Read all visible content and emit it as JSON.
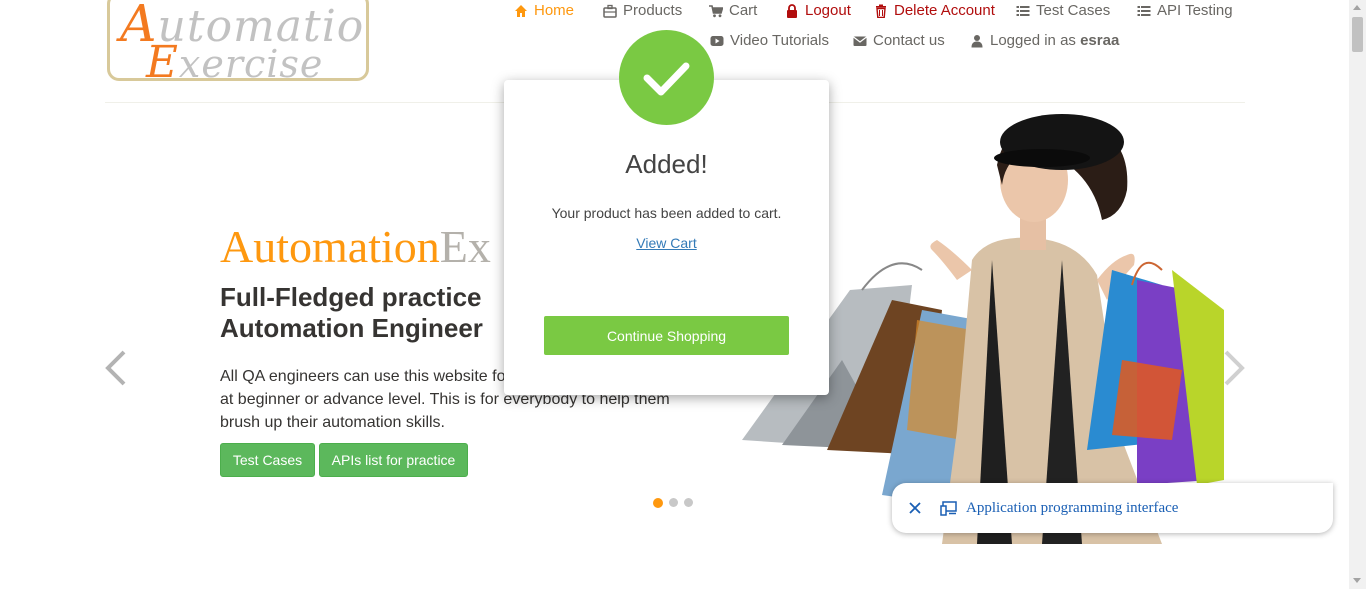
{
  "logo": {
    "line1_first": "A",
    "line1_rest": "utomation",
    "line2_first": "E",
    "line2_rest": "xercise"
  },
  "nav": {
    "home": "Home",
    "products": "Products",
    "cart": "Cart",
    "logout": "Logout",
    "delete_account": "Delete Account",
    "test_cases": "Test Cases",
    "api_testing": "API Testing",
    "video_tutorials": "Video Tutorials",
    "contact_us": "Contact us",
    "logged_in_prefix": "Logged in as",
    "username": "esraa"
  },
  "slider": {
    "brand_a": "Automation",
    "brand_b": "Ex",
    "headline": "Full-Fledged practice Automation Engineer",
    "description": "All QA engineers can use this website fo API testing either they are at beginner or advance level. This is for everybody to help them brush up their automation skills.",
    "btn_test_cases": "Test Cases",
    "btn_apis": "APIs list for practice",
    "active_slide": 1,
    "slide_count": 3
  },
  "modal": {
    "title": "Added!",
    "message": "Your product has been added to cart.",
    "view_cart": "View Cart",
    "continue": "Continue Shopping"
  },
  "bubble": {
    "text": "Application programming interface"
  },
  "colors": {
    "accent": "#fe980f",
    "green": "#7ac943",
    "button_green": "#5cb85c",
    "danger": "#b10d0d",
    "link": "#337ab7"
  }
}
